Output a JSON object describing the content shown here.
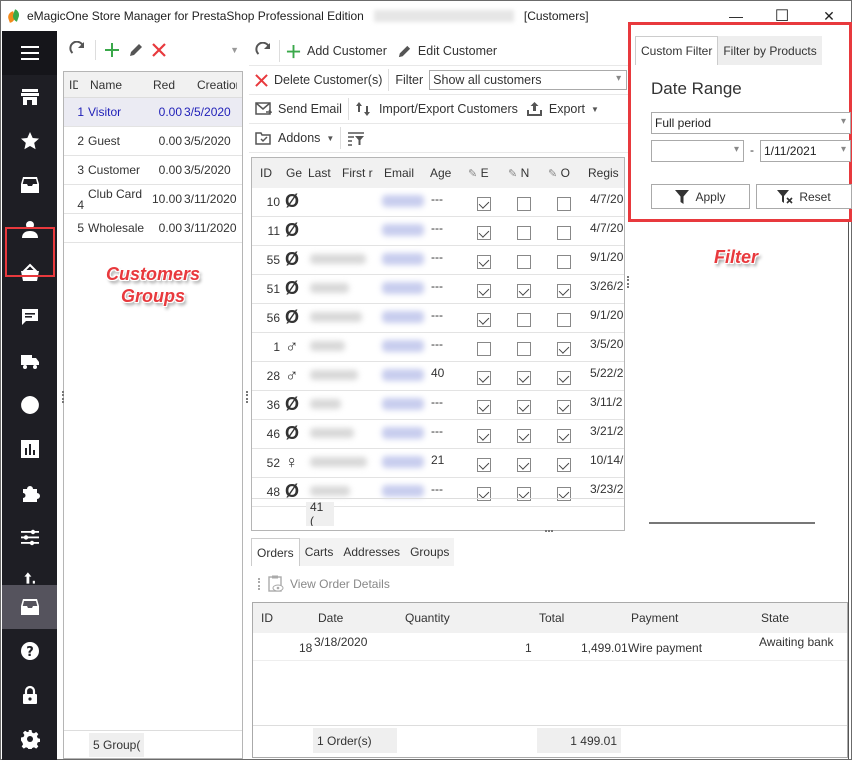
{
  "window": {
    "title": "eMagicOne Store Manager for PrestaShop Professional Edition",
    "section": "[Customers]",
    "controls": {
      "minimize": "—",
      "maximize": "☐",
      "close": "✕"
    }
  },
  "sidebar": {
    "items": [
      {
        "name": "menu",
        "icon": "hamburger-icon"
      },
      {
        "name": "store",
        "icon": "store-icon"
      },
      {
        "name": "favorites",
        "icon": "star-icon"
      },
      {
        "name": "inventory",
        "icon": "archive-icon"
      },
      {
        "name": "customers",
        "icon": "user-icon",
        "highlighted": true
      },
      {
        "name": "orders",
        "icon": "basket-icon"
      },
      {
        "name": "messages",
        "icon": "chat-icon"
      },
      {
        "name": "shipping",
        "icon": "truck-icon"
      },
      {
        "name": "localization",
        "icon": "globe-icon"
      },
      {
        "name": "reports",
        "icon": "bar-chart-icon"
      },
      {
        "name": "addons",
        "icon": "puzzle-icon"
      },
      {
        "name": "preferences",
        "icon": "sliders-icon"
      },
      {
        "name": "import-export",
        "icon": "upload-icon"
      },
      {
        "name": "storage",
        "icon": "archive-icon",
        "active": true
      },
      {
        "name": "help",
        "icon": "help-icon"
      },
      {
        "name": "security",
        "icon": "lock-icon"
      },
      {
        "name": "settings",
        "icon": "gear-icon"
      }
    ]
  },
  "groups": {
    "columns": [
      "ID",
      "Name",
      "Red",
      "Creation"
    ],
    "rows": [
      {
        "id": "1",
        "name": "Visitor",
        "reduction": "0.00",
        "created": "3/5/2020",
        "selected": true
      },
      {
        "id": "2",
        "name": "Guest",
        "reduction": "0.00",
        "created": "3/5/2020"
      },
      {
        "id": "3",
        "name": "Customer",
        "reduction": "0.00",
        "created": "3/5/2020"
      },
      {
        "id": "4",
        "name": "Club Card",
        "reduction": "10.00",
        "created": "3/11/2020"
      },
      {
        "id": "5",
        "name": "Wholesale",
        "reduction": "0.00",
        "created": "3/11/2020"
      }
    ],
    "footer": "5 Group("
  },
  "customers": {
    "toolbar": {
      "add": "Add Customer",
      "edit": "Edit Customer",
      "delete": "Delete Customer(s)",
      "filter_label": "Filter",
      "filter_value": "Show all customers",
      "send_email": "Send Email",
      "import_export": "Import/Export Customers",
      "export": "Export",
      "addons": "Addons"
    },
    "columns": [
      "ID",
      "Ge",
      "Last",
      "First r",
      "Email",
      "Age",
      "E",
      "N",
      "O",
      "Regis"
    ],
    "rows": [
      {
        "id": "10",
        "gender": "Ø",
        "age": "---",
        "e": true,
        "n": false,
        "o": false,
        "reg": "4/7/20"
      },
      {
        "id": "11",
        "gender": "Ø",
        "age": "---",
        "e": true,
        "n": false,
        "o": false,
        "reg": "4/7/20"
      },
      {
        "id": "55",
        "gender": "Ø",
        "age": "---",
        "e": true,
        "n": false,
        "o": false,
        "reg": "9/1/20"
      },
      {
        "id": "51",
        "gender": "Ø",
        "age": "---",
        "e": true,
        "n": true,
        "o": true,
        "reg": "3/26/2"
      },
      {
        "id": "56",
        "gender": "Ø",
        "age": "---",
        "e": true,
        "n": false,
        "o": false,
        "reg": "9/1/20"
      },
      {
        "id": "1",
        "gender": "♂",
        "age": "---",
        "e": false,
        "n": false,
        "o": true,
        "reg": "3/5/20"
      },
      {
        "id": "28",
        "gender": "♂",
        "age": "40",
        "e": true,
        "n": true,
        "o": true,
        "reg": "5/22/2"
      },
      {
        "id": "36",
        "gender": "Ø",
        "age": "---",
        "e": true,
        "n": true,
        "o": true,
        "reg": "3/11/2"
      },
      {
        "id": "46",
        "gender": "Ø",
        "age": "---",
        "e": true,
        "n": true,
        "o": true,
        "reg": "3/21/2"
      },
      {
        "id": "52",
        "gender": "♀",
        "age": "21",
        "e": true,
        "n": true,
        "o": true,
        "reg": "10/14/"
      },
      {
        "id": "48",
        "gender": "Ø",
        "age": "---",
        "e": true,
        "n": true,
        "o": true,
        "reg": "3/23/2"
      }
    ],
    "footer": "41 ("
  },
  "detail_tabs": [
    "Orders",
    "Carts",
    "Addresses",
    "Groups"
  ],
  "orders": {
    "action": "View Order Details",
    "columns": [
      "ID",
      "Date",
      "Quantity",
      "Total",
      "Payment",
      "State"
    ],
    "rows": [
      {
        "id": "18",
        "date": "3/18/2020",
        "quantity": "1",
        "total": "1,499.01",
        "payment": "Wire payment",
        "state": "Awaiting bank"
      }
    ],
    "footer_count": "1 Order(s)",
    "footer_total": "1 499.01"
  },
  "filter_panel": {
    "tabs": [
      "Custom Filter",
      "Filter by Products"
    ],
    "heading": "Date Range",
    "period": "Full period",
    "date_from": "",
    "date_separator": "-",
    "date_to": "1/11/2021",
    "apply": "Apply",
    "reset": "Reset"
  },
  "annotations": {
    "groups_label_line1": "Customers",
    "groups_label_line2": "Groups",
    "filter_label": "Filter"
  },
  "colors": {
    "highlight": "#e8393d",
    "sidebar": "#1e1e24",
    "selected_text": "#1f1fb8"
  }
}
